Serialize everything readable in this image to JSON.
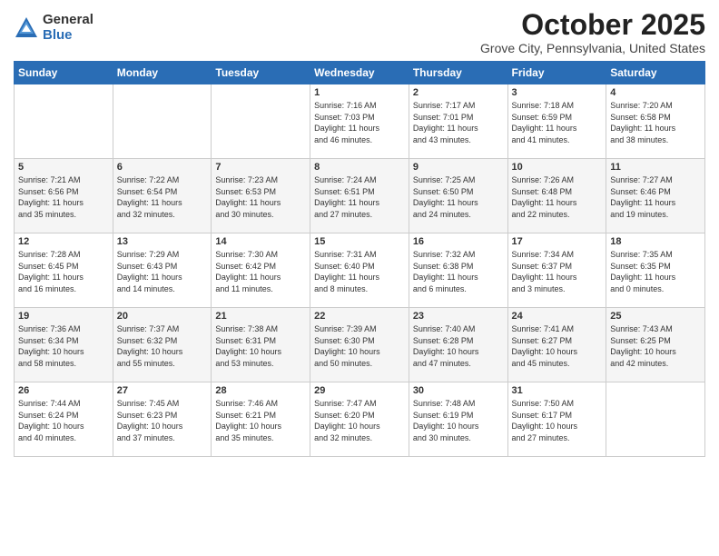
{
  "logo": {
    "general": "General",
    "blue": "Blue"
  },
  "header": {
    "month": "October 2025",
    "location": "Grove City, Pennsylvania, United States"
  },
  "days_of_week": [
    "Sunday",
    "Monday",
    "Tuesday",
    "Wednesday",
    "Thursday",
    "Friday",
    "Saturday"
  ],
  "weeks": [
    [
      {
        "day": "",
        "info": ""
      },
      {
        "day": "",
        "info": ""
      },
      {
        "day": "",
        "info": ""
      },
      {
        "day": "1",
        "info": "Sunrise: 7:16 AM\nSunset: 7:03 PM\nDaylight: 11 hours\nand 46 minutes."
      },
      {
        "day": "2",
        "info": "Sunrise: 7:17 AM\nSunset: 7:01 PM\nDaylight: 11 hours\nand 43 minutes."
      },
      {
        "day": "3",
        "info": "Sunrise: 7:18 AM\nSunset: 6:59 PM\nDaylight: 11 hours\nand 41 minutes."
      },
      {
        "day": "4",
        "info": "Sunrise: 7:20 AM\nSunset: 6:58 PM\nDaylight: 11 hours\nand 38 minutes."
      }
    ],
    [
      {
        "day": "5",
        "info": "Sunrise: 7:21 AM\nSunset: 6:56 PM\nDaylight: 11 hours\nand 35 minutes."
      },
      {
        "day": "6",
        "info": "Sunrise: 7:22 AM\nSunset: 6:54 PM\nDaylight: 11 hours\nand 32 minutes."
      },
      {
        "day": "7",
        "info": "Sunrise: 7:23 AM\nSunset: 6:53 PM\nDaylight: 11 hours\nand 30 minutes."
      },
      {
        "day": "8",
        "info": "Sunrise: 7:24 AM\nSunset: 6:51 PM\nDaylight: 11 hours\nand 27 minutes."
      },
      {
        "day": "9",
        "info": "Sunrise: 7:25 AM\nSunset: 6:50 PM\nDaylight: 11 hours\nand 24 minutes."
      },
      {
        "day": "10",
        "info": "Sunrise: 7:26 AM\nSunset: 6:48 PM\nDaylight: 11 hours\nand 22 minutes."
      },
      {
        "day": "11",
        "info": "Sunrise: 7:27 AM\nSunset: 6:46 PM\nDaylight: 11 hours\nand 19 minutes."
      }
    ],
    [
      {
        "day": "12",
        "info": "Sunrise: 7:28 AM\nSunset: 6:45 PM\nDaylight: 11 hours\nand 16 minutes."
      },
      {
        "day": "13",
        "info": "Sunrise: 7:29 AM\nSunset: 6:43 PM\nDaylight: 11 hours\nand 14 minutes."
      },
      {
        "day": "14",
        "info": "Sunrise: 7:30 AM\nSunset: 6:42 PM\nDaylight: 11 hours\nand 11 minutes."
      },
      {
        "day": "15",
        "info": "Sunrise: 7:31 AM\nSunset: 6:40 PM\nDaylight: 11 hours\nand 8 minutes."
      },
      {
        "day": "16",
        "info": "Sunrise: 7:32 AM\nSunset: 6:38 PM\nDaylight: 11 hours\nand 6 minutes."
      },
      {
        "day": "17",
        "info": "Sunrise: 7:34 AM\nSunset: 6:37 PM\nDaylight: 11 hours\nand 3 minutes."
      },
      {
        "day": "18",
        "info": "Sunrise: 7:35 AM\nSunset: 6:35 PM\nDaylight: 11 hours\nand 0 minutes."
      }
    ],
    [
      {
        "day": "19",
        "info": "Sunrise: 7:36 AM\nSunset: 6:34 PM\nDaylight: 10 hours\nand 58 minutes."
      },
      {
        "day": "20",
        "info": "Sunrise: 7:37 AM\nSunset: 6:32 PM\nDaylight: 10 hours\nand 55 minutes."
      },
      {
        "day": "21",
        "info": "Sunrise: 7:38 AM\nSunset: 6:31 PM\nDaylight: 10 hours\nand 53 minutes."
      },
      {
        "day": "22",
        "info": "Sunrise: 7:39 AM\nSunset: 6:30 PM\nDaylight: 10 hours\nand 50 minutes."
      },
      {
        "day": "23",
        "info": "Sunrise: 7:40 AM\nSunset: 6:28 PM\nDaylight: 10 hours\nand 47 minutes."
      },
      {
        "day": "24",
        "info": "Sunrise: 7:41 AM\nSunset: 6:27 PM\nDaylight: 10 hours\nand 45 minutes."
      },
      {
        "day": "25",
        "info": "Sunrise: 7:43 AM\nSunset: 6:25 PM\nDaylight: 10 hours\nand 42 minutes."
      }
    ],
    [
      {
        "day": "26",
        "info": "Sunrise: 7:44 AM\nSunset: 6:24 PM\nDaylight: 10 hours\nand 40 minutes."
      },
      {
        "day": "27",
        "info": "Sunrise: 7:45 AM\nSunset: 6:23 PM\nDaylight: 10 hours\nand 37 minutes."
      },
      {
        "day": "28",
        "info": "Sunrise: 7:46 AM\nSunset: 6:21 PM\nDaylight: 10 hours\nand 35 minutes."
      },
      {
        "day": "29",
        "info": "Sunrise: 7:47 AM\nSunset: 6:20 PM\nDaylight: 10 hours\nand 32 minutes."
      },
      {
        "day": "30",
        "info": "Sunrise: 7:48 AM\nSunset: 6:19 PM\nDaylight: 10 hours\nand 30 minutes."
      },
      {
        "day": "31",
        "info": "Sunrise: 7:50 AM\nSunset: 6:17 PM\nDaylight: 10 hours\nand 27 minutes."
      },
      {
        "day": "",
        "info": ""
      }
    ]
  ]
}
